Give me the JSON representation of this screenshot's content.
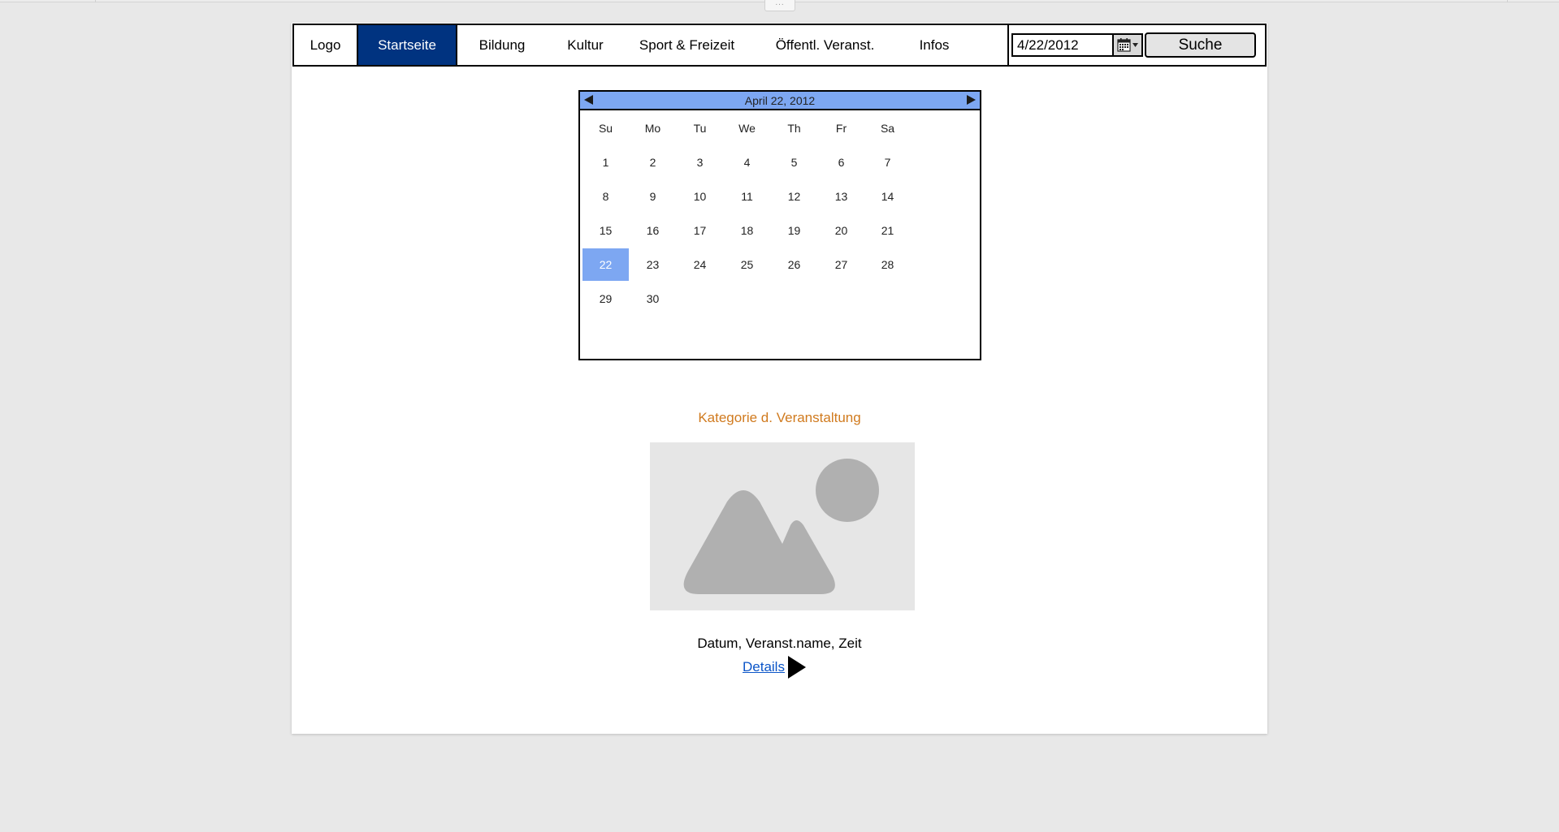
{
  "nav": {
    "items": [
      {
        "label": "Logo"
      },
      {
        "label": "Startseite"
      },
      {
        "label": "Bildung"
      },
      {
        "label": "Kultur"
      },
      {
        "label": "Sport & Freizeit"
      },
      {
        "label": "Öffentl. Veranst."
      },
      {
        "label": "Infos"
      }
    ],
    "active_index": 1,
    "active_color": "#003380"
  },
  "search": {
    "date_value": "4/22/2012",
    "button_label": "Suche"
  },
  "calendar": {
    "title": "April 22, 2012",
    "weekdays": [
      "Su",
      "Mo",
      "Tu",
      "We",
      "Th",
      "Fr",
      "Sa"
    ],
    "days": [
      "1",
      "2",
      "3",
      "4",
      "5",
      "6",
      "7",
      "8",
      "9",
      "10",
      "11",
      "12",
      "13",
      "14",
      "15",
      "16",
      "17",
      "18",
      "19",
      "20",
      "21",
      "22",
      "23",
      "24",
      "25",
      "26",
      "27",
      "28",
      "29",
      "30"
    ],
    "first_weekday_index": 0,
    "selected_day": "22",
    "accent_color": "#7da7f2"
  },
  "event": {
    "category": "Kategorie d. Veranstaltung",
    "category_color": "#d07a1e",
    "info": "Datum, Veranst.name, Zeit",
    "details_label": "Details"
  },
  "icons": {
    "handle": "ellipsis-icon",
    "calendar_button": "calendar-icon",
    "image": "image-placeholder-icon",
    "details": "play-arrow-icon"
  },
  "handle_text": "..."
}
